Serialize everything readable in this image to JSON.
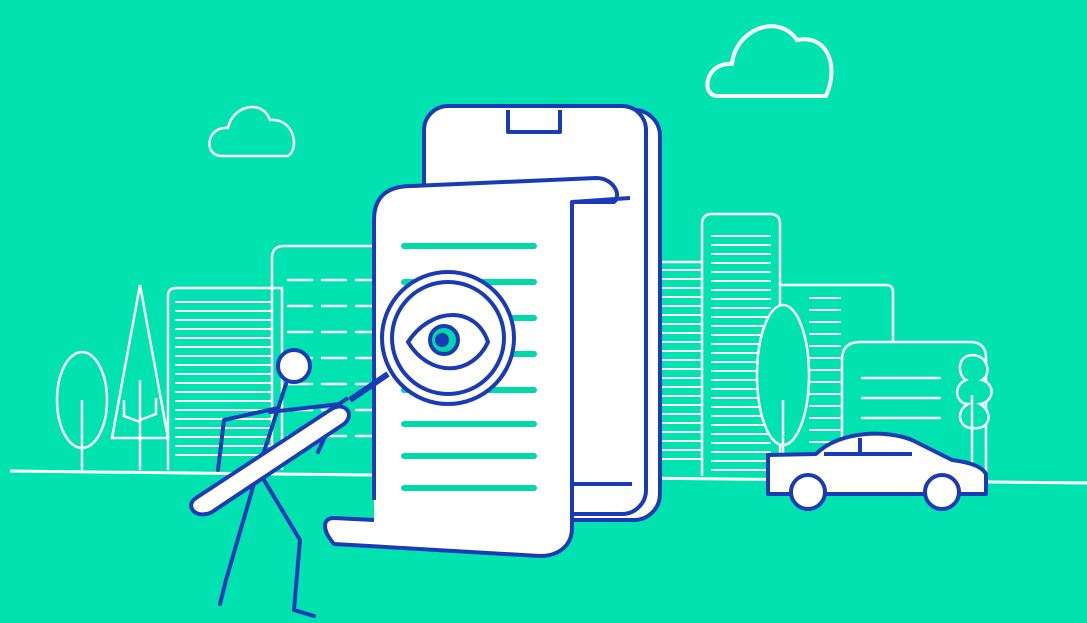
{
  "colors": {
    "background": "#00E3B0",
    "line_white": "#FFFFFF",
    "ink_blue": "#1A3BB8",
    "accent_green": "#00D9A9",
    "paper": "#FFFFFF"
  },
  "icons": {
    "cloud": "cloud-icon",
    "eye": "eye-icon",
    "magnifier": "magnifying-glass-icon",
    "phone": "smartphone-icon",
    "document": "scroll-document-icon",
    "car": "car-icon",
    "tree": "tree-icon",
    "person": "person-icon",
    "building": "building-icon"
  }
}
